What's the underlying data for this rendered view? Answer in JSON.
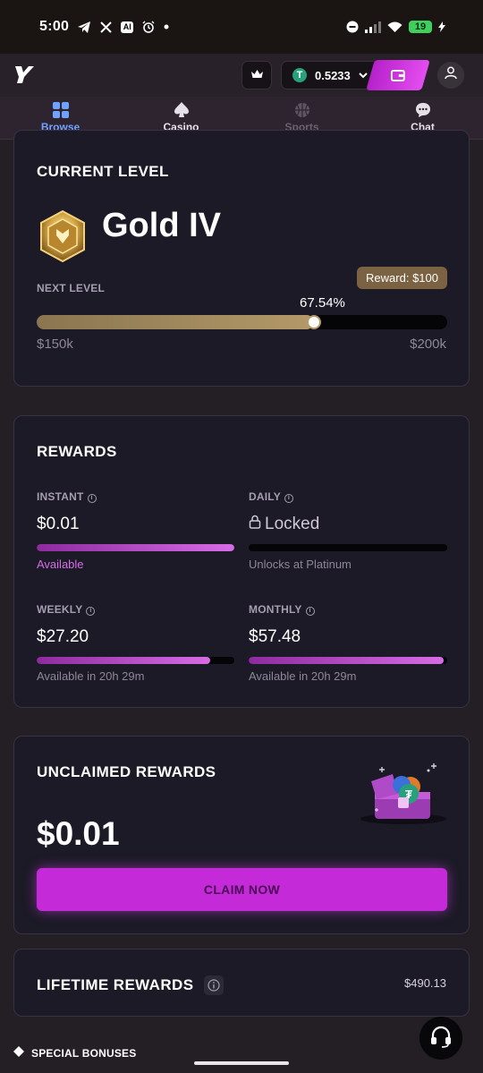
{
  "status_bar": {
    "time": "5:00",
    "ai_badge": "AI",
    "battery": "19"
  },
  "header": {
    "balance": "0.5233",
    "currency_icon": "tether-icon",
    "currency_symbol": "T"
  },
  "nav": {
    "items": [
      {
        "label": "Browse",
        "icon": "grid-icon",
        "state": "active"
      },
      {
        "label": "Casino",
        "icon": "spade-icon",
        "state": "normal"
      },
      {
        "label": "Sports",
        "icon": "basketball-icon",
        "state": "disabled"
      },
      {
        "label": "Chat",
        "icon": "chat-bubble-icon",
        "state": "normal"
      }
    ]
  },
  "level_card": {
    "title": "CURRENT LEVEL",
    "level_name": "Gold IV",
    "next_level_label": "NEXT LEVEL",
    "reward_badge": "Reward: $100",
    "progress_label": "67.54%",
    "progress_fraction": 0.6754,
    "range_start": "$150k",
    "range_end": "$200k",
    "colors": {
      "progress": "#b49a69",
      "badge": "#7a6242"
    }
  },
  "rewards_card": {
    "title": "REWARDS",
    "items": [
      {
        "label": "INSTANT",
        "value": "$0.01",
        "status": "Available",
        "fraction": 1.0
      },
      {
        "label": "DAILY",
        "value": "Locked",
        "status": "Unlocks at Platinum",
        "fraction": 0.0
      },
      {
        "label": "WEEKLY",
        "value": "$27.20",
        "status": "Available in 20h 29m",
        "fraction": 0.88
      },
      {
        "label": "MONTHLY",
        "value": "$57.48",
        "status": "Available in 20h 29m",
        "fraction": 0.98
      }
    ],
    "colors": {
      "bar": "#d86ce6",
      "available": "#d56de6"
    }
  },
  "unclaimed_card": {
    "title": "UNCLAIMED REWARDS",
    "amount": "$0.01",
    "button": "CLAIM NOW",
    "colors": {
      "button": "#c42ad8"
    }
  },
  "lifetime_card": {
    "title": "LIFETIME REWARDS",
    "amount": "$490.13"
  },
  "special_bonuses": {
    "label": "SPECIAL BONUSES"
  }
}
